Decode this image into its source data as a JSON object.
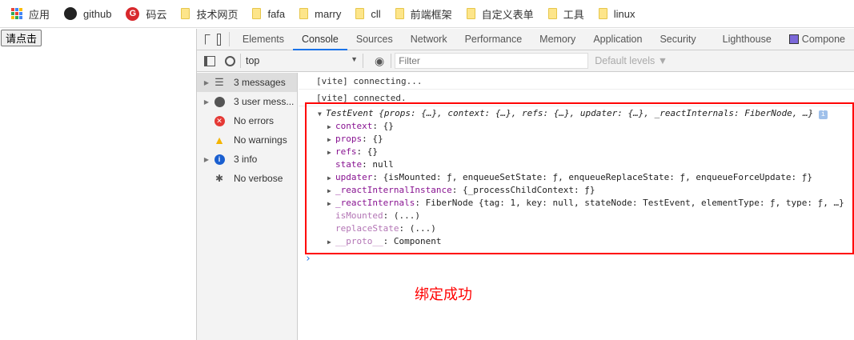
{
  "bookmarks": [
    {
      "label": "应用",
      "icon": "apps-icon"
    },
    {
      "label": "github",
      "icon": "github-icon"
    },
    {
      "label": "码云",
      "icon": "gitee-icon"
    },
    {
      "label": "技术网页",
      "icon": "folder-icon"
    },
    {
      "label": "fafa",
      "icon": "folder-icon"
    },
    {
      "label": "marry",
      "icon": "folder-icon"
    },
    {
      "label": "cll",
      "icon": "folder-icon"
    },
    {
      "label": "前端框架",
      "icon": "folder-icon"
    },
    {
      "label": "自定义表单",
      "icon": "folder-icon"
    },
    {
      "label": "工具",
      "icon": "folder-icon"
    },
    {
      "label": "linux",
      "icon": "folder-icon"
    }
  ],
  "page": {
    "button": "请点击",
    "annotation": "绑定成功"
  },
  "devtools": {
    "tabs": [
      "Elements",
      "Console",
      "Sources",
      "Network",
      "Performance",
      "Memory",
      "Application",
      "Security",
      "Lighthouse",
      "Compone"
    ],
    "active_tab": "Console",
    "context": "top",
    "filter_placeholder": "Filter",
    "levels": "Default levels ▼",
    "sidebar": [
      {
        "label": "3 messages",
        "icon": "list-icon"
      },
      {
        "label": "3 user mess...",
        "icon": "user-icon"
      },
      {
        "label": "No errors",
        "icon": "error-icon"
      },
      {
        "label": "No warnings",
        "icon": "warning-icon"
      },
      {
        "label": "3 info",
        "icon": "info-icon"
      },
      {
        "label": "No verbose",
        "icon": "bug-icon"
      }
    ],
    "logs": [
      "[vite] connecting...",
      "[vite] connected."
    ],
    "object": {
      "summary_name": "TestEvent",
      "summary": "{props: {…}, context: {…}, refs: {…}, updater: {…}, _reactInternals: FiberNode, …}",
      "props": [
        {
          "key": "context",
          "value": "{}",
          "expandable": true
        },
        {
          "key": "props",
          "value": "{}",
          "expandable": true
        },
        {
          "key": "refs",
          "value": "{}",
          "expandable": true
        },
        {
          "key": "state",
          "value": "null",
          "expandable": false
        },
        {
          "key": "updater",
          "value": "{isMounted: ƒ, enqueueSetState: ƒ, enqueueReplaceState: ƒ, enqueueForceUpdate: ƒ}",
          "expandable": true
        },
        {
          "key": "_reactInternalInstance",
          "value": "{_processChildContext: ƒ}",
          "expandable": true
        },
        {
          "key": "_reactInternals",
          "value": "FiberNode {tag: 1, key: null, stateNode: TestEvent, elementType: ƒ, type: ƒ, …}",
          "expandable": true
        },
        {
          "key": "isMounted",
          "value": "(...)",
          "expandable": false,
          "dim": true
        },
        {
          "key": "replaceState",
          "value": "(...)",
          "expandable": false,
          "dim": true
        },
        {
          "key": "__proto__",
          "value": "Component",
          "expandable": true,
          "dim": true
        }
      ]
    },
    "prompt": "›"
  }
}
